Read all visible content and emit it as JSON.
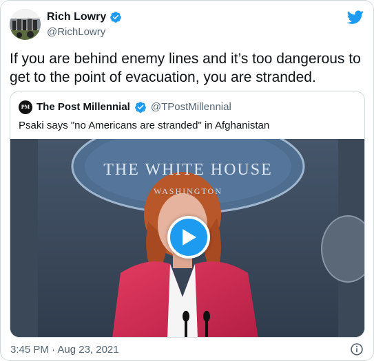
{
  "author": {
    "display_name": "Rich Lowry",
    "handle": "@RichLowry",
    "verified": true,
    "avatar_icon": "profile-photo"
  },
  "tweet": {
    "text": "If you are behind enemy lines and it’s too dangerous to get to the point of evacuation, you are stranded.",
    "timestamp": "3:45 PM · Aug 23, 2021"
  },
  "quoted_tweet": {
    "avatar_initials": "PM",
    "display_name": "The Post Millennial",
    "handle": "@TPostMillennial",
    "verified": true,
    "text": "Psaki says \"no Americans are stranded\" in Afghanistan",
    "media": {
      "type": "video",
      "seal_text": "THE WHITE HOUSE",
      "seal_sub_text": "WASHINGTON",
      "play_icon": "play-icon"
    }
  },
  "colors": {
    "twitter_blue": "#1d9bf0",
    "text_primary": "#0f1419",
    "text_secondary": "#536471",
    "border": "#cfd9de"
  },
  "icons": {
    "logo": "twitter-bird-icon",
    "verified": "verified-badge-icon",
    "info": "info-icon"
  }
}
